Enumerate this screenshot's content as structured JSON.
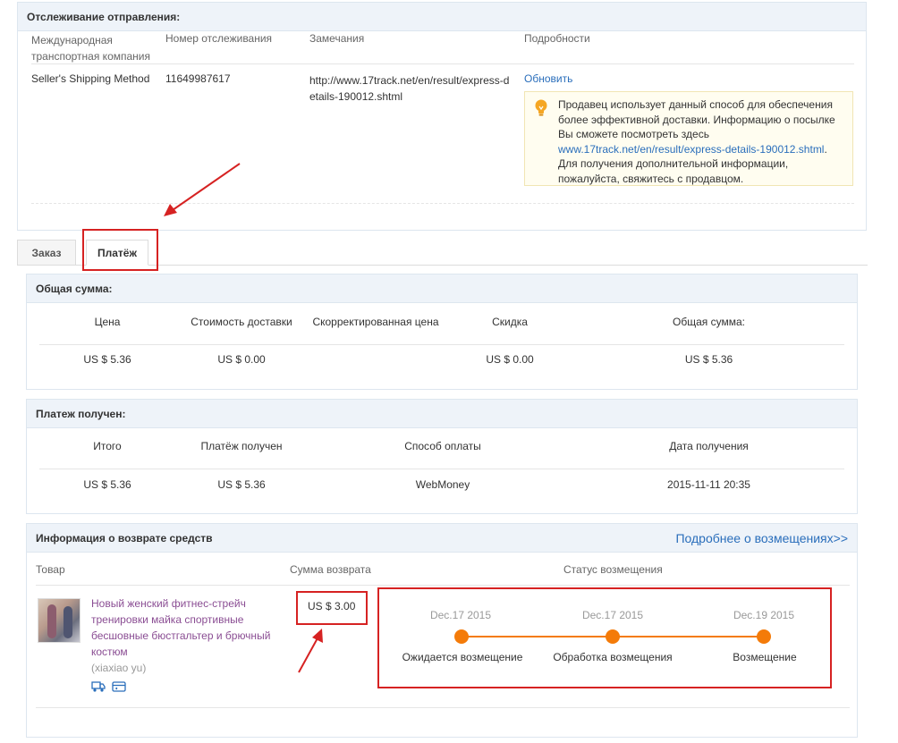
{
  "tracking": {
    "title": "Отслеживание отправления:",
    "headers": {
      "carrier": "Международная транспортная компания",
      "number": "Номер отслеживания",
      "notes": "Замечания",
      "details": "Подробности"
    },
    "row": {
      "carrier": "Seller's Shipping Method",
      "number": "11649987617",
      "notes": "http://www.17track.net/en/result/express-details-190012.shtml",
      "update_link": "Обновить"
    },
    "tip": {
      "line1": "Продавец использует данный способ для обеспечения более эффективной доставки. Информацию о посылке Вы сможете посмотреть здесь",
      "link": "www.17track.net/en/result/express-details-190012.shtml",
      "line2": ".",
      "line3": "Для получения дополнительной информации, пожалуйста, свяжитесь с продавцом."
    }
  },
  "tabs": {
    "order": "Заказ",
    "payment": "Платёж"
  },
  "total": {
    "title": "Общая сумма:",
    "headers": {
      "price": "Цена",
      "shipping": "Стоимость доставки",
      "adjusted": "Скорректированная цена",
      "discount": "Скидка",
      "total": "Общая сумма:"
    },
    "values": {
      "price": "US $ 5.36",
      "shipping": "US $ 0.00",
      "adjusted": "",
      "discount": "US $ 0.00",
      "total": "US $ 5.36"
    }
  },
  "received": {
    "title": "Платеж получен:",
    "headers": {
      "sum": "Итого",
      "received": "Платёж получен",
      "method": "Способ оплаты",
      "date": "Дата получения"
    },
    "values": {
      "sum": "US $ 5.36",
      "received": "US $ 5.36",
      "method": "WebMoney",
      "date": "2015-11-11 20:35"
    }
  },
  "refund": {
    "title": "Информация о возврате средств",
    "more_link": "Подробнее о возмещениях>>",
    "headers": {
      "product": "Товар",
      "amount": "Сумма возврата",
      "status": "Статус возмещения"
    },
    "product": {
      "title": "Новый женский фитнес-стрейч тренировки майка спортивные бесшовные бюстгальтер и брючный костюм",
      "seller": "(xiaxiao yu)"
    },
    "amount": "US $ 3.00",
    "timeline": [
      {
        "date": "Dec.17 2015",
        "label": "Ожидается возмещение"
      },
      {
        "date": "Dec.17 2015",
        "label": "Обработка возмещения"
      },
      {
        "date": "Dec.19 2015",
        "label": "Возмещение"
      }
    ]
  },
  "colors": {
    "accent_link": "#2a6ebb",
    "product_link": "#8a4d93",
    "timeline": "#f47b09",
    "annotation": "#d62222",
    "panel_header_bg": "#eef3f9"
  },
  "icons": [
    "bulb-icon",
    "truck-icon",
    "card-icon"
  ]
}
